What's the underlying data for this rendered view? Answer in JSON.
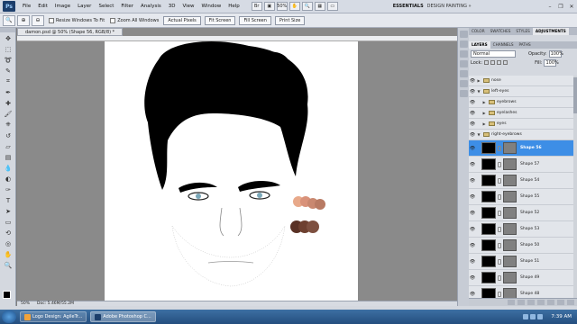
{
  "menubar": {
    "logo": "Ps",
    "items": [
      "File",
      "Edit",
      "Image",
      "Layer",
      "Select",
      "Filter",
      "Analysis",
      "3D",
      "View",
      "Window",
      "Help"
    ],
    "zoom": "50%",
    "workspace": "ESSENTIALS",
    "more": "DESIGN  PAINTING  »"
  },
  "options": {
    "resize_label": "Resize Windows To Fit",
    "zoom_all_label": "Zoom All Windows",
    "actual_pixels": "Actual Pixels",
    "fit_screen": "Fit Screen",
    "fill_screen": "Fill Screen",
    "print_size": "Print Size"
  },
  "document": {
    "tab_title": "damon.psd @ 50% (Shape 56, RGB/8) *",
    "zoom": "50%",
    "doc_size": "Doc: 5.46M/55.2M"
  },
  "panels": {
    "top_tabs": [
      "COLOR",
      "SWATCHES",
      "STYLES",
      "ADJUSTMENTS"
    ],
    "layer_tabs": [
      "LAYERS",
      "CHANNELS",
      "PATHS"
    ],
    "blend_mode": "Normal",
    "opacity_label": "Opacity:",
    "opacity_value": "100%",
    "lock_label": "Lock:",
    "fill_label": "Fill:",
    "fill_value": "100%"
  },
  "layers": {
    "groups": [
      {
        "name": "nose",
        "level": 1,
        "open": false
      },
      {
        "name": "left-eyes",
        "level": 1,
        "open": true
      },
      {
        "name": "eyebrows",
        "level": 2,
        "open": false
      },
      {
        "name": "eyelashes",
        "level": 2,
        "open": false
      },
      {
        "name": "eyes",
        "level": 2,
        "open": false
      },
      {
        "name": "right-eyebrows",
        "level": 1,
        "open": true
      }
    ],
    "shapes": [
      {
        "name": "Shape 56",
        "selected": true
      },
      {
        "name": "Shape 57",
        "selected": false
      },
      {
        "name": "Shape 54",
        "selected": false
      },
      {
        "name": "Shape 55",
        "selected": false
      },
      {
        "name": "Shape 52",
        "selected": false
      },
      {
        "name": "Shape 53",
        "selected": false
      },
      {
        "name": "Shape 50",
        "selected": false
      },
      {
        "name": "Shape 51",
        "selected": false
      },
      {
        "name": "Shape 49",
        "selected": false
      },
      {
        "name": "Shape 48",
        "selected": false
      }
    ]
  },
  "taskbar": {
    "items": [
      "Logo Design: AgileTr...",
      "Adobe Photoshop C..."
    ],
    "clock": "7:39 AM"
  },
  "colors": {
    "skin_swatches": [
      "#e8a98a",
      "#d9927a",
      "#c98870",
      "#b87a63"
    ],
    "brown_swatches": [
      "#5a3226",
      "#6e4030",
      "#7e5040"
    ],
    "eye_color": "#7aa7b8",
    "selection": "#3d8ee6"
  }
}
